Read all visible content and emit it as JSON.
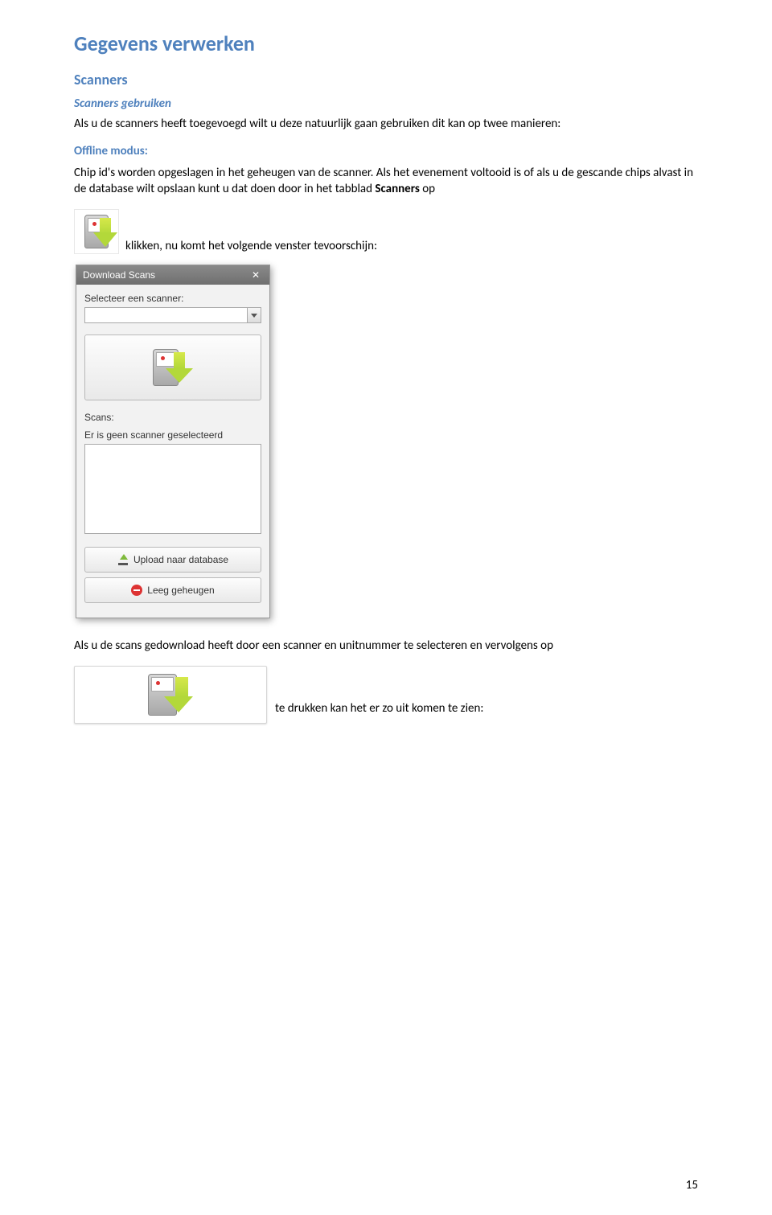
{
  "headings": {
    "h1": "Gegevens verwerken",
    "h2": "Scanners",
    "h3": "Scanners gebruiken",
    "offline": "Offline modus:"
  },
  "paragraphs": {
    "intro": "Als u de scanners heeft toegevoegd wilt u deze natuurlijk gaan gebruiken dit kan op twee manieren:",
    "chip_before": "Chip id's worden opgeslagen in het geheugen van de scanner. Als het evenement voltooid is of als u de gescande chips alvast in de database wilt opslaan kunt u dat doen door in het tabblad ",
    "chip_bold": "Scanners",
    "chip_after": " op",
    "after_icon": "klikken, nu  komt het volgende venster tevoorschijn:",
    "after_dialog": "Als u de scans gedownload heeft door een scanner en unitnummer te selecteren en vervolgens op",
    "after_big_btn": "te drukken kan het er zo uit komen te zien:"
  },
  "dialog": {
    "title": "Download Scans",
    "select_label": "Selecteer een scanner:",
    "scans_label": "Scans:",
    "no_scanner": "Er is geen scanner geselecteerd",
    "upload_btn": "Upload naar database",
    "clear_btn": "Leeg geheugen"
  },
  "page_number": "15"
}
